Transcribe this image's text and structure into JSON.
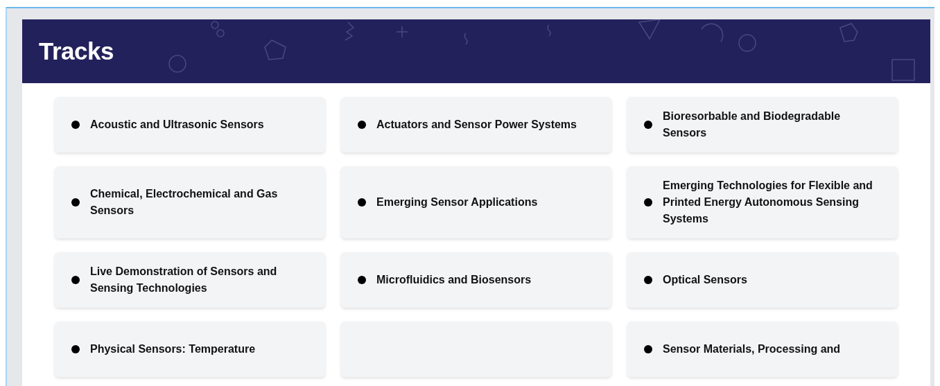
{
  "header": {
    "title": "Tracks"
  },
  "tracks": [
    {
      "kind": "track",
      "label": "Acoustic and Ultrasonic Sensors"
    },
    {
      "kind": "track",
      "label": "Actuators and Sensor Power Systems"
    },
    {
      "kind": "track",
      "label": "Bioresorbable and Biodegradable Sensors"
    },
    {
      "kind": "track",
      "label": "Chemical, Electrochemical and Gas Sensors"
    },
    {
      "kind": "track",
      "label": "Emerging Sensor Applications"
    },
    {
      "kind": "track",
      "label": "Emerging Technologies for Flexible and Printed Energy Autonomous Sensing Systems"
    },
    {
      "kind": "track",
      "label": "Live Demonstration of Sensors and Sensing Technologies"
    },
    {
      "kind": "track",
      "label": "Microfluidics and Biosensors"
    },
    {
      "kind": "track",
      "label": "Optical Sensors"
    },
    {
      "kind": "track",
      "label": "Physical Sensors: Temperature"
    },
    {
      "kind": "blank"
    },
    {
      "kind": "track",
      "label": "Sensor Materials, Processing and"
    }
  ]
}
